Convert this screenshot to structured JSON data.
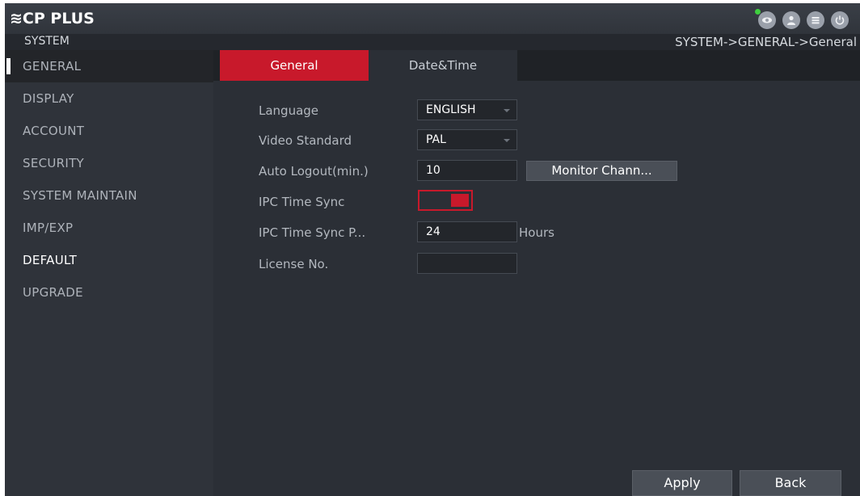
{
  "header": {
    "brand": "≋CP PLUS",
    "icons": [
      "eye-icon",
      "user-icon",
      "menu-icon",
      "power-icon"
    ],
    "section": "SYSTEM",
    "breadcrumb": "SYSTEM->GENERAL->General"
  },
  "sidebar": {
    "items": [
      {
        "label": "GENERAL",
        "active": true
      },
      {
        "label": "DISPLAY"
      },
      {
        "label": "ACCOUNT"
      },
      {
        "label": "SECURITY"
      },
      {
        "label": "SYSTEM MAINTAIN"
      },
      {
        "label": "IMP/EXP"
      },
      {
        "label": "DEFAULT"
      },
      {
        "label": "UPGRADE"
      }
    ]
  },
  "tabs": [
    {
      "label": "General",
      "active": true
    },
    {
      "label": "Date&Time"
    }
  ],
  "form": {
    "language": {
      "label": "Language",
      "value": "ENGLISH"
    },
    "video_standard": {
      "label": "Video Standard",
      "value": "PAL"
    },
    "auto_logout": {
      "label": "Auto Logout(min.)",
      "value": "10",
      "button": "Monitor Chann..."
    },
    "ipc_time_sync": {
      "label": "IPC Time Sync",
      "enabled": true
    },
    "ipc_time_sync_period": {
      "label": "IPC Time Sync P...",
      "value": "24",
      "unit": "Hours"
    },
    "license_no": {
      "label": "License No.",
      "value": ""
    }
  },
  "footer": {
    "apply_label": "Apply",
    "back_label": "Back"
  },
  "colors": {
    "accent": "#c8192b",
    "background": "#2b2f36",
    "sidebar": "#2f333a"
  }
}
